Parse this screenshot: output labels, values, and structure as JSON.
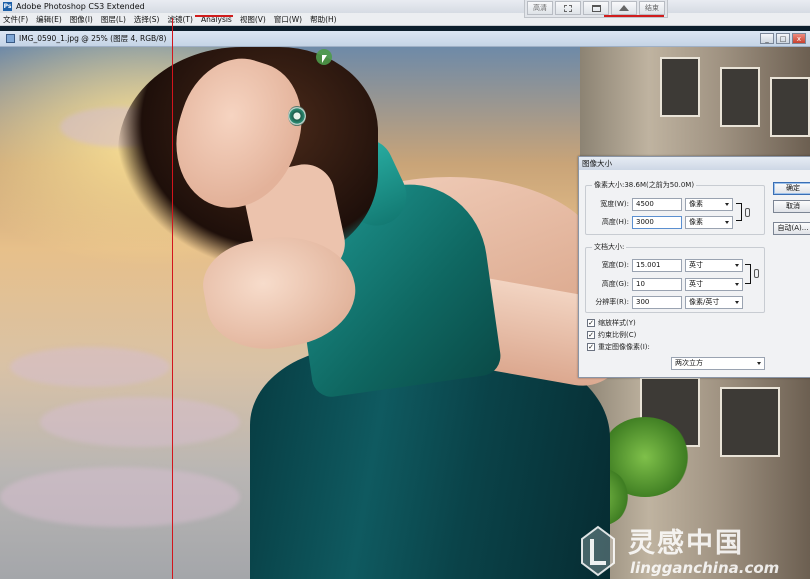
{
  "app": {
    "title": "Adobe Photoshop CS3 Extended",
    "icon_label": "Ps"
  },
  "menu": [
    "文件(F)",
    "编辑(E)",
    "图像(I)",
    "图层(L)",
    "选择(S)",
    "滤镜(T)",
    "Analysis",
    "视图(V)",
    "窗口(W)",
    "帮助(H)"
  ],
  "view_toolbar": {
    "left_label": "高清",
    "right_label": "结束",
    "icons": [
      "marquee-icon",
      "window-icon",
      "home-icon"
    ]
  },
  "document": {
    "title": "IMG_0590_1.jpg @ 25% (图层 4, RGB/8)",
    "controls": [
      "_",
      "□",
      "x"
    ]
  },
  "dialog": {
    "title": "图像大小",
    "pixel_dims_label": "像素大小:38.6M(之前为50.0M)",
    "width_label": "宽度(W):",
    "width_value": "4500",
    "width_unit": "像素",
    "height_label": "高度(H):",
    "height_value": "3000",
    "height_unit": "像素",
    "doc_size_label": "文档大小:",
    "doc_width_label": "宽度(D):",
    "doc_width_value": "15.001",
    "doc_width_unit": "英寸",
    "doc_height_label": "高度(G):",
    "doc_height_value": "10",
    "doc_height_unit": "英寸",
    "resolution_label": "分辨率(R):",
    "resolution_value": "300",
    "resolution_unit": "像素/英寸",
    "scale_styles_label": "缩放样式(Y)",
    "constrain_label": "约束比例(C)",
    "resample_label": "重定图像像素(I):",
    "resample_method": "两次立方",
    "ok_label": "确定",
    "cancel_label": "取消",
    "auto_label": "自动(A)..."
  },
  "watermark": {
    "cn": "灵感中国",
    "en": "lingganchina.com"
  },
  "colors": {
    "guide": "#d3141c",
    "dress": "#0f5a60",
    "accent": "#3a6fb5"
  }
}
